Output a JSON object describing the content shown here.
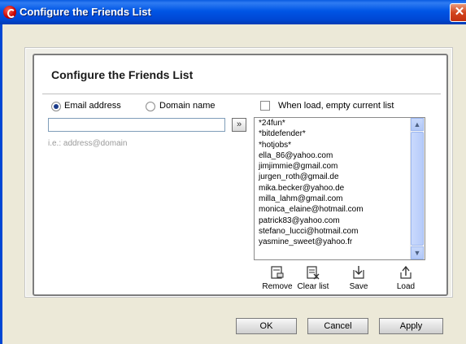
{
  "window": {
    "title": "Configure the Friends List",
    "close_symbol": "✕"
  },
  "panel": {
    "heading": "Configure the Friends List"
  },
  "options": {
    "email_label": "Email address",
    "domain_label": "Domain name",
    "selected": "Email address"
  },
  "empty_option": {
    "label": "When load, empty current list",
    "checked": false
  },
  "input": {
    "value": "",
    "hint": "i.e.: address@domain",
    "add_symbol": "»"
  },
  "friends": [
    "*24fun*",
    "*bitdefender*",
    "*hotjobs*",
    "ella_86@yahoo.com",
    "jimjimmie@gmail.com",
    "jurgen_roth@gmail.de",
    "mika.becker@yahoo.de",
    "milla_lahm@gmail.com",
    "monica_elaine@hotmail.com",
    "patrick83@yahoo.com",
    "stefano_lucci@hotmail.com",
    "yasmine_sweet@yahoo.fr"
  ],
  "list_tools": [
    {
      "label": "Remove",
      "icon": "remove-icon"
    },
    {
      "label": "Clear list",
      "icon": "clear-list-icon"
    },
    {
      "label": "Save",
      "icon": "save-icon"
    },
    {
      "label": "Load",
      "icon": "load-icon"
    }
  ],
  "buttons": {
    "ok": "OK",
    "cancel": "Cancel",
    "apply": "Apply"
  },
  "colors": {
    "titlebar": "#0055e5",
    "close_button": "#d2451e",
    "scroll_accent": "#b6cbfa"
  }
}
